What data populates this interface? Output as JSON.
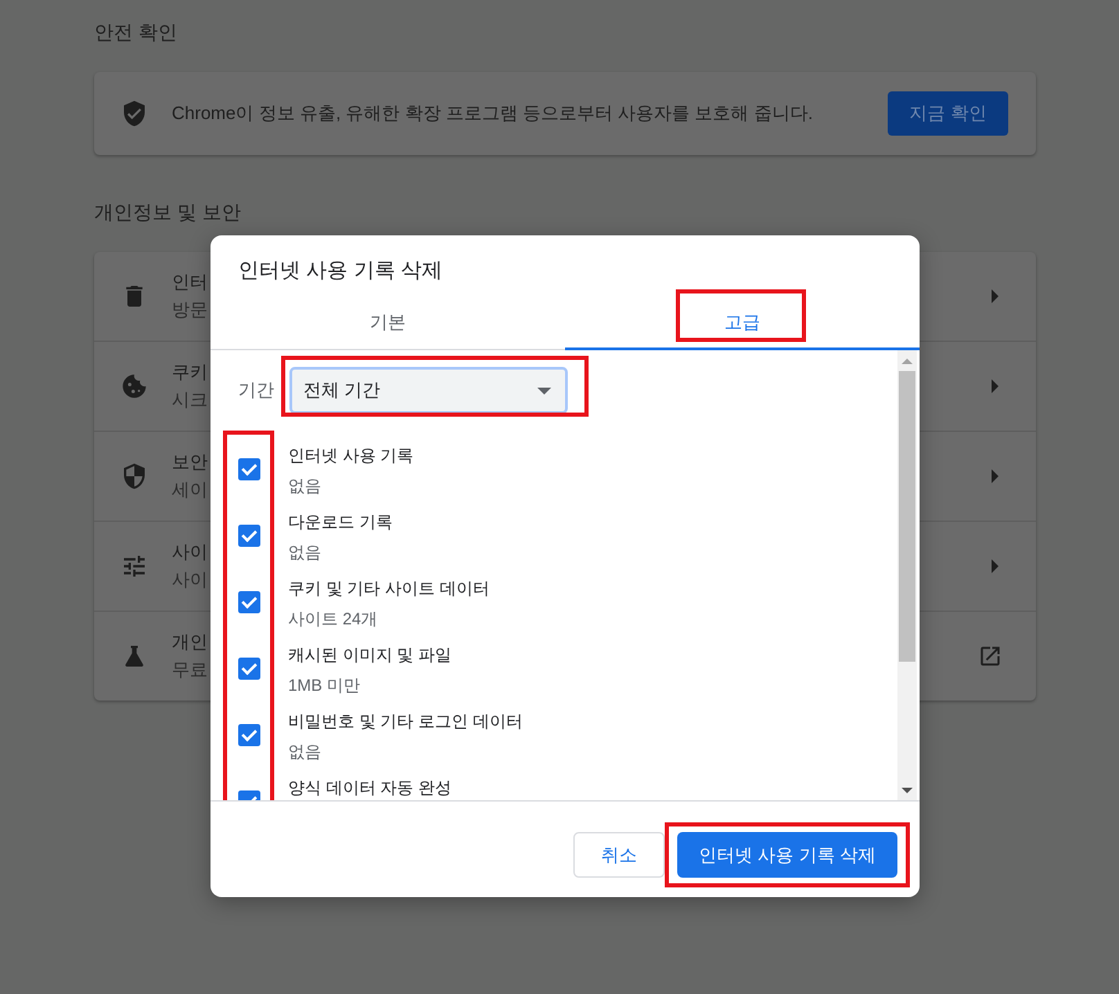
{
  "safety_check": {
    "heading": "안전 확인",
    "description": "Chrome이 정보 유출, 유해한 확장 프로그램 등으로부터 사용자를 보호해 줍니다.",
    "button": "지금 확인"
  },
  "privacy": {
    "heading": "개인정보 및 보안",
    "rows": [
      {
        "kind": "trash",
        "title": "인터",
        "subtitle": "방문",
        "external_link": false
      },
      {
        "kind": "cookie",
        "title": "쿠키",
        "subtitle": "시크",
        "external_link": false
      },
      {
        "kind": "shield",
        "title": "보안",
        "subtitle": "세이",
        "external_link": false
      },
      {
        "kind": "sliders",
        "title": "사이",
        "subtitle": "사이",
        "external_link": false
      },
      {
        "kind": "flask",
        "title": "개인",
        "subtitle": "무료",
        "external_link": true
      }
    ]
  },
  "dialog": {
    "title": "인터넷 사용 기록 삭제",
    "tabs": [
      {
        "label": "기본",
        "selected": false,
        "highlighted": false
      },
      {
        "label": "고급",
        "selected": true,
        "highlighted": true
      }
    ],
    "period": {
      "label": "기간",
      "value": "전체 기간",
      "highlighted": true
    },
    "checkboxes_highlighted": true,
    "items": [
      {
        "title": "인터넷 사용 기록",
        "detail": "없음",
        "checked": true
      },
      {
        "title": "다운로드 기록",
        "detail": "없음",
        "checked": true
      },
      {
        "title": "쿠키 및 기타 사이트 데이터",
        "detail": "사이트 24개",
        "checked": true
      },
      {
        "title": "캐시된 이미지 및 파일",
        "detail": "1MB 미만",
        "checked": true
      },
      {
        "title": "비밀번호 및 기타 로그인 데이터",
        "detail": "없음",
        "checked": true
      },
      {
        "title": "양식 데이터 자동 완성",
        "checked": true
      }
    ],
    "buttons": [
      {
        "kind": "secondary",
        "label": "취소",
        "highlighted": false
      },
      {
        "kind": "primary",
        "label": "인터넷 사용 기록 삭제",
        "highlighted": true
      }
    ]
  }
}
